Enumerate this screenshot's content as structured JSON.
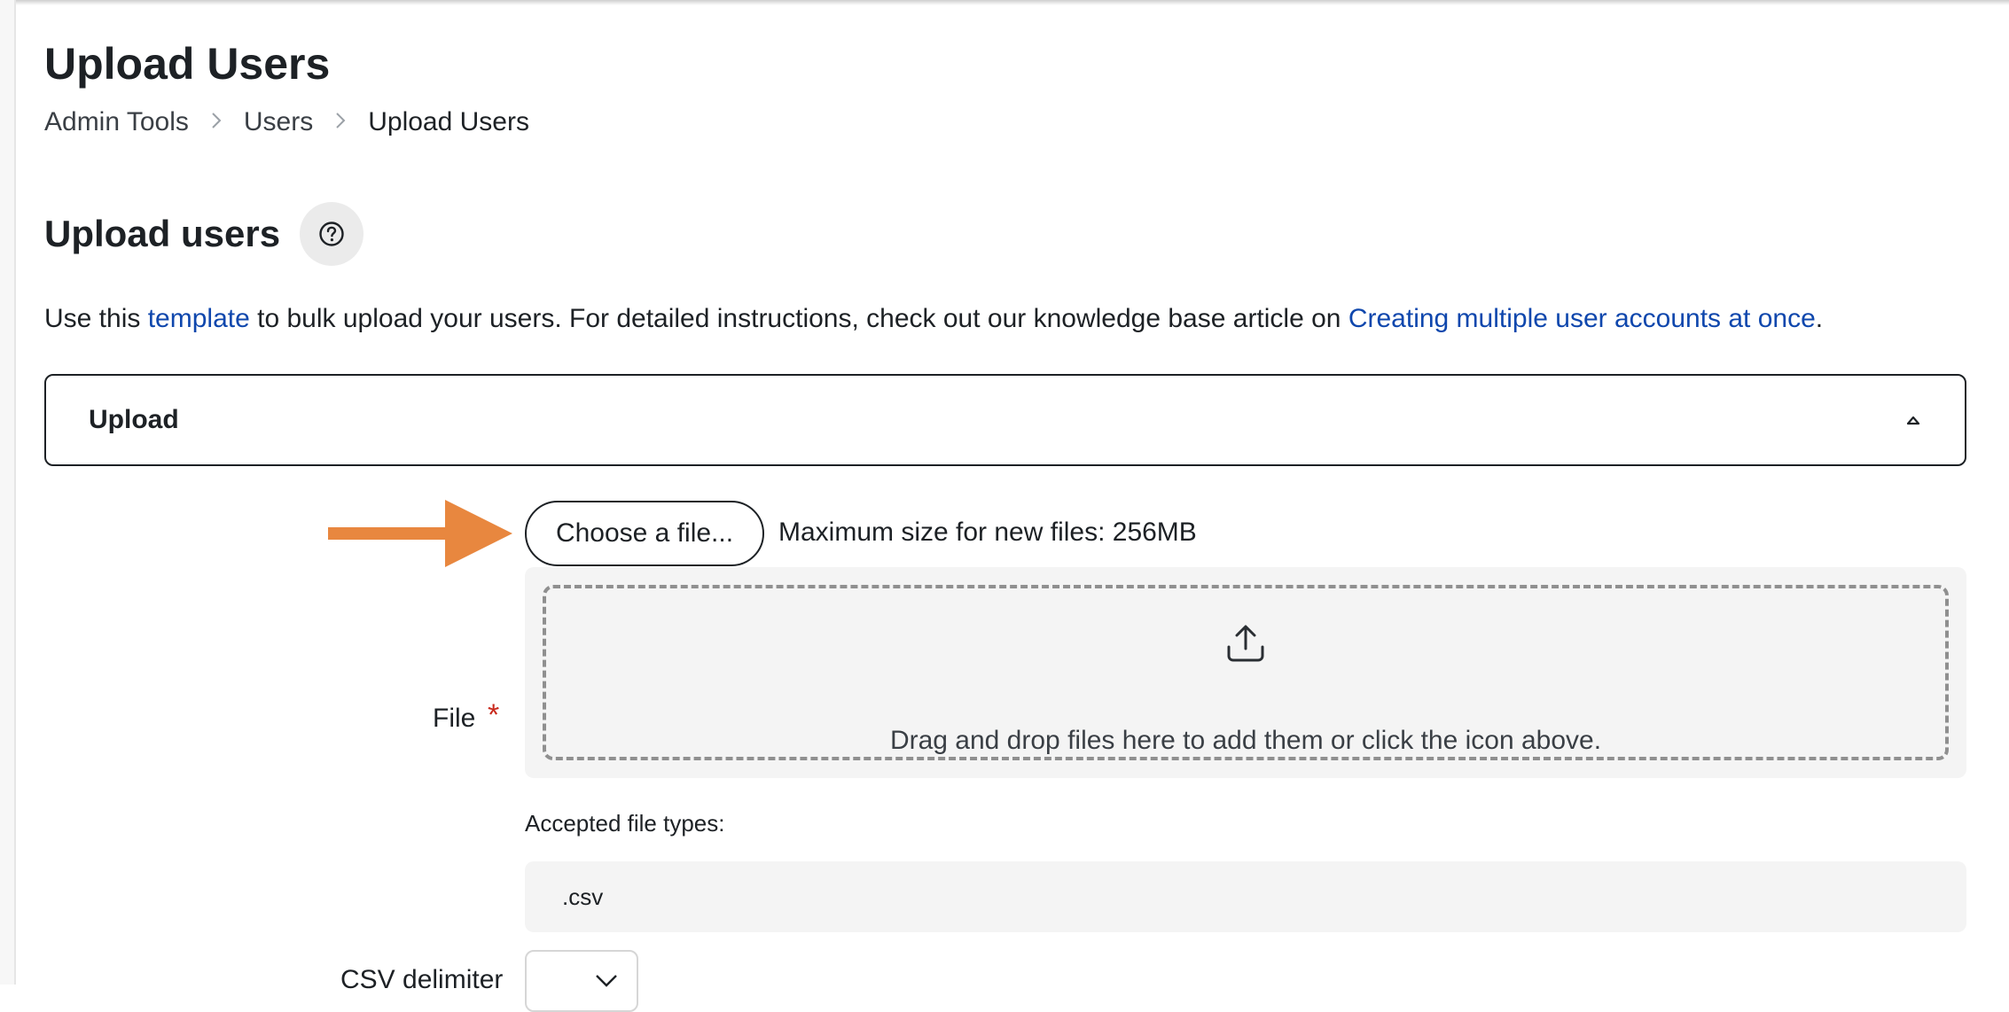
{
  "page": {
    "title": "Upload Users"
  },
  "breadcrumb": {
    "items": [
      "Admin Tools",
      "Users",
      "Upload Users"
    ]
  },
  "section": {
    "heading": "Upload users",
    "help_icon": "help-circle-icon"
  },
  "intro": {
    "before_link": "Use this ",
    "template_link": "template",
    "middle": " to bulk upload your users. For detailed instructions, check out our knowledge base article on ",
    "article_link": "Creating multiple user accounts at once",
    "after": "."
  },
  "upload_panel": {
    "title": "Upload",
    "collapse_icon": "caret-up-icon"
  },
  "file_picker": {
    "label": "File",
    "required_mark": "*",
    "choose_button": "Choose a file...",
    "max_size": "Maximum size for new files: 256MB",
    "dropzone_icon": "upload-icon",
    "dropzone_text": "Drag and drop files here to add them or click the icon above.",
    "accepted_label": "Accepted file types:",
    "accepted_types": ".csv"
  },
  "csv": {
    "label": "CSV delimiter",
    "select_icon": "chevron-down-icon"
  },
  "colors": {
    "link": "#0f47ad",
    "required": "#c9291c",
    "annotation_arrow": "#e8873f",
    "panel_bg": "#f4f4f4"
  },
  "annotation": {
    "icon": "arrow-right-icon"
  }
}
